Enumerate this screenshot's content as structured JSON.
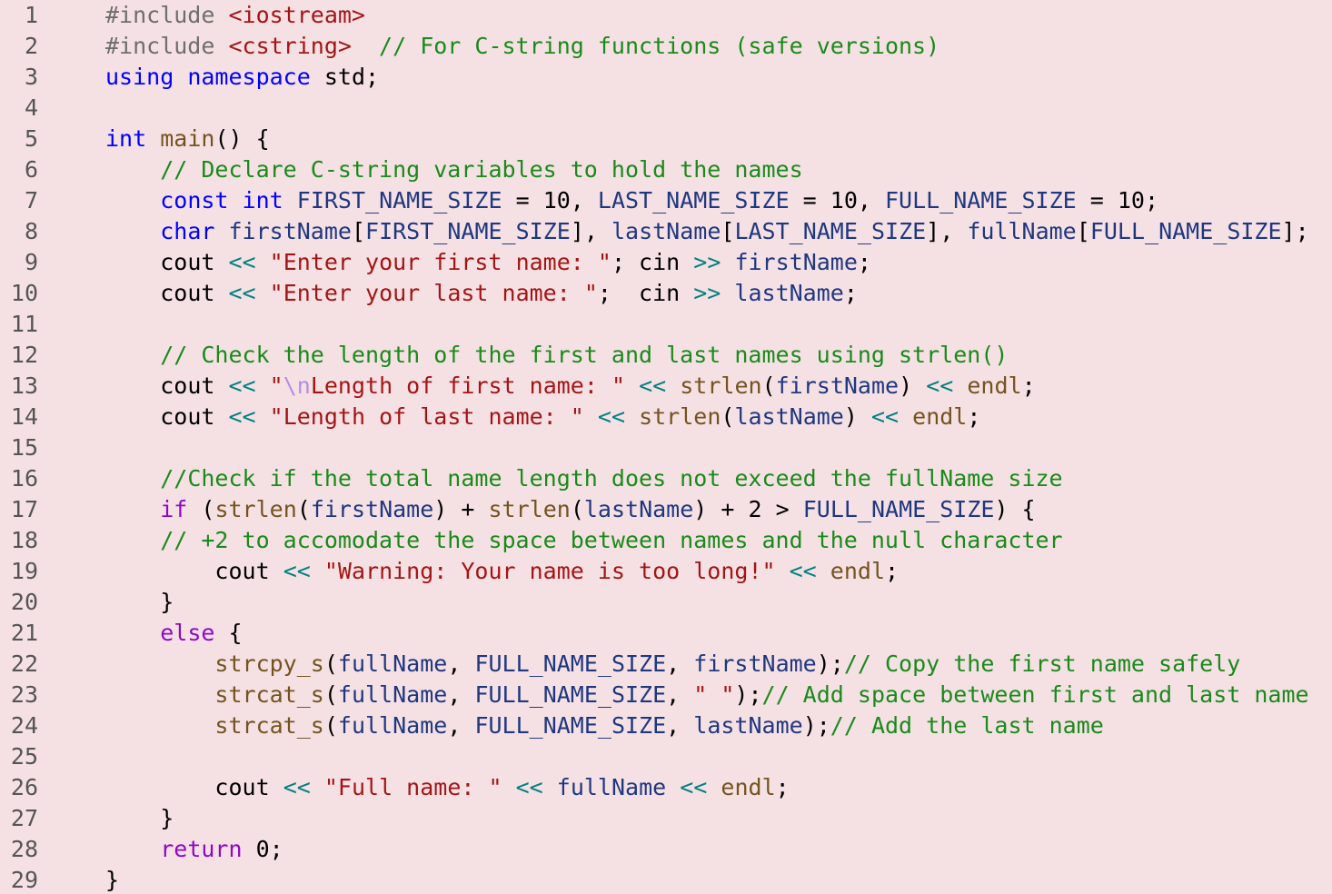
{
  "editor": {
    "indent_unit": "    ",
    "colors": {
      "background": "#f5e1e4",
      "line_number": "#555555",
      "preproc": "#6e6e6e",
      "header": "#a31515",
      "comment": "#1a8a1a",
      "keyword": "#0000ff",
      "control": "#8f08c4",
      "function": "#74531f",
      "string": "#a31515",
      "escape": "#b68ce6",
      "variable": "#1f377f",
      "operator": "#008080"
    },
    "lines": [
      {
        "n": "1",
        "indent": 0,
        "tokens": [
          [
            "preproc",
            "#include "
          ],
          [
            "header",
            "<iostream>"
          ]
        ]
      },
      {
        "n": "2",
        "indent": 0,
        "tokens": [
          [
            "preproc",
            "#include "
          ],
          [
            "header",
            "<cstring>"
          ],
          [
            "plain",
            "  "
          ],
          [
            "comment",
            "// For C-string functions (safe versions)"
          ]
        ]
      },
      {
        "n": "3",
        "indent": 0,
        "tokens": [
          [
            "keyword",
            "using"
          ],
          [
            "plain",
            " "
          ],
          [
            "keyword",
            "namespace"
          ],
          [
            "plain",
            " std;"
          ]
        ]
      },
      {
        "n": "4",
        "indent": 0,
        "tokens": []
      },
      {
        "n": "5",
        "indent": 0,
        "tokens": [
          [
            "keyword",
            "int"
          ],
          [
            "plain",
            " "
          ],
          [
            "func",
            "main"
          ],
          [
            "plain",
            "() {"
          ]
        ]
      },
      {
        "n": "6",
        "indent": 1,
        "tokens": [
          [
            "comment",
            "// Declare C-string variables to hold the names"
          ]
        ]
      },
      {
        "n": "7",
        "indent": 1,
        "tokens": [
          [
            "keyword",
            "const"
          ],
          [
            "plain",
            " "
          ],
          [
            "keyword",
            "int"
          ],
          [
            "plain",
            " "
          ],
          [
            "macro",
            "FIRST_NAME_SIZE"
          ],
          [
            "plain",
            " = 10, "
          ],
          [
            "macro",
            "LAST_NAME_SIZE"
          ],
          [
            "plain",
            " = 10, "
          ],
          [
            "macro",
            "FULL_NAME_SIZE"
          ],
          [
            "plain",
            " = 10;"
          ]
        ]
      },
      {
        "n": "8",
        "indent": 1,
        "tokens": [
          [
            "keyword",
            "char"
          ],
          [
            "plain",
            " "
          ],
          [
            "var",
            "firstName"
          ],
          [
            "plain",
            "["
          ],
          [
            "macro",
            "FIRST_NAME_SIZE"
          ],
          [
            "plain",
            "], "
          ],
          [
            "var",
            "lastName"
          ],
          [
            "plain",
            "["
          ],
          [
            "macro",
            "LAST_NAME_SIZE"
          ],
          [
            "plain",
            "], "
          ],
          [
            "var",
            "fullName"
          ],
          [
            "plain",
            "["
          ],
          [
            "macro",
            "FULL_NAME_SIZE"
          ],
          [
            "plain",
            "];"
          ]
        ]
      },
      {
        "n": "9",
        "indent": 1,
        "tokens": [
          [
            "plain",
            "cout "
          ],
          [
            "op",
            "<<"
          ],
          [
            "plain",
            " "
          ],
          [
            "string",
            "\"Enter your first name: \""
          ],
          [
            "plain",
            "; cin "
          ],
          [
            "op",
            ">>"
          ],
          [
            "plain",
            " "
          ],
          [
            "var",
            "firstName"
          ],
          [
            "plain",
            ";"
          ]
        ]
      },
      {
        "n": "10",
        "indent": 1,
        "tokens": [
          [
            "plain",
            "cout "
          ],
          [
            "op",
            "<<"
          ],
          [
            "plain",
            " "
          ],
          [
            "string",
            "\"Enter your last name: \""
          ],
          [
            "plain",
            ";  cin "
          ],
          [
            "op",
            ">>"
          ],
          [
            "plain",
            " "
          ],
          [
            "var",
            "lastName"
          ],
          [
            "plain",
            ";"
          ]
        ]
      },
      {
        "n": "11",
        "indent": 0,
        "tokens": []
      },
      {
        "n": "12",
        "indent": 1,
        "tokens": [
          [
            "comment",
            "// Check the length of the first and last names using strlen()"
          ]
        ]
      },
      {
        "n": "13",
        "indent": 1,
        "tokens": [
          [
            "plain",
            "cout "
          ],
          [
            "op",
            "<<"
          ],
          [
            "plain",
            " "
          ],
          [
            "string",
            "\""
          ],
          [
            "escape",
            "\\n"
          ],
          [
            "string",
            "Length of first name: \""
          ],
          [
            "plain",
            " "
          ],
          [
            "op",
            "<<"
          ],
          [
            "plain",
            " "
          ],
          [
            "func",
            "strlen"
          ],
          [
            "plain",
            "("
          ],
          [
            "var",
            "firstName"
          ],
          [
            "plain",
            ") "
          ],
          [
            "op",
            "<<"
          ],
          [
            "plain",
            " "
          ],
          [
            "func",
            "endl"
          ],
          [
            "plain",
            ";"
          ]
        ]
      },
      {
        "n": "14",
        "indent": 1,
        "tokens": [
          [
            "plain",
            "cout "
          ],
          [
            "op",
            "<<"
          ],
          [
            "plain",
            " "
          ],
          [
            "string",
            "\"Length of last name: \""
          ],
          [
            "plain",
            " "
          ],
          [
            "op",
            "<<"
          ],
          [
            "plain",
            " "
          ],
          [
            "func",
            "strlen"
          ],
          [
            "plain",
            "("
          ],
          [
            "var",
            "lastName"
          ],
          [
            "plain",
            ") "
          ],
          [
            "op",
            "<<"
          ],
          [
            "plain",
            " "
          ],
          [
            "func",
            "endl"
          ],
          [
            "plain",
            ";"
          ]
        ]
      },
      {
        "n": "15",
        "indent": 0,
        "tokens": []
      },
      {
        "n": "16",
        "indent": 1,
        "tokens": [
          [
            "comment",
            "//Check if the total name length does not exceed the fullName size"
          ]
        ]
      },
      {
        "n": "17",
        "indent": 1,
        "tokens": [
          [
            "control",
            "if"
          ],
          [
            "plain",
            " ("
          ],
          [
            "func",
            "strlen"
          ],
          [
            "plain",
            "("
          ],
          [
            "var",
            "firstName"
          ],
          [
            "plain",
            ") + "
          ],
          [
            "func",
            "strlen"
          ],
          [
            "plain",
            "("
          ],
          [
            "var",
            "lastName"
          ],
          [
            "plain",
            ") + 2 > "
          ],
          [
            "macro",
            "FULL_NAME_SIZE"
          ],
          [
            "plain",
            ") {"
          ]
        ]
      },
      {
        "n": "18",
        "indent": 1,
        "tokens": [
          [
            "comment",
            "// +2 to accomodate the space between names and the null character"
          ]
        ]
      },
      {
        "n": "19",
        "indent": 2,
        "tokens": [
          [
            "plain",
            "cout "
          ],
          [
            "op",
            "<<"
          ],
          [
            "plain",
            " "
          ],
          [
            "string",
            "\"Warning: Your name is too long!\""
          ],
          [
            "plain",
            " "
          ],
          [
            "op",
            "<<"
          ],
          [
            "plain",
            " "
          ],
          [
            "func",
            "endl"
          ],
          [
            "plain",
            ";"
          ]
        ]
      },
      {
        "n": "20",
        "indent": 1,
        "tokens": [
          [
            "plain",
            "}"
          ]
        ]
      },
      {
        "n": "21",
        "indent": 1,
        "tokens": [
          [
            "control",
            "else"
          ],
          [
            "plain",
            " {"
          ]
        ]
      },
      {
        "n": "22",
        "indent": 2,
        "tokens": [
          [
            "func",
            "strcpy_s"
          ],
          [
            "plain",
            "("
          ],
          [
            "var",
            "fullName"
          ],
          [
            "plain",
            ", "
          ],
          [
            "macro",
            "FULL_NAME_SIZE"
          ],
          [
            "plain",
            ", "
          ],
          [
            "var",
            "firstName"
          ],
          [
            "plain",
            ");"
          ],
          [
            "comment",
            "// Copy the first name safely"
          ]
        ]
      },
      {
        "n": "23",
        "indent": 2,
        "tokens": [
          [
            "func",
            "strcat_s"
          ],
          [
            "plain",
            "("
          ],
          [
            "var",
            "fullName"
          ],
          [
            "plain",
            ", "
          ],
          [
            "macro",
            "FULL_NAME_SIZE"
          ],
          [
            "plain",
            ", "
          ],
          [
            "string",
            "\" \""
          ],
          [
            "plain",
            ");"
          ],
          [
            "comment",
            "// Add space between first and last name"
          ]
        ]
      },
      {
        "n": "24",
        "indent": 2,
        "tokens": [
          [
            "func",
            "strcat_s"
          ],
          [
            "plain",
            "("
          ],
          [
            "var",
            "fullName"
          ],
          [
            "plain",
            ", "
          ],
          [
            "macro",
            "FULL_NAME_SIZE"
          ],
          [
            "plain",
            ", "
          ],
          [
            "var",
            "lastName"
          ],
          [
            "plain",
            ");"
          ],
          [
            "comment",
            "// Add the last name"
          ]
        ]
      },
      {
        "n": "25",
        "indent": 0,
        "tokens": []
      },
      {
        "n": "26",
        "indent": 2,
        "tokens": [
          [
            "plain",
            "cout "
          ],
          [
            "op",
            "<<"
          ],
          [
            "plain",
            " "
          ],
          [
            "string",
            "\"Full name: \""
          ],
          [
            "plain",
            " "
          ],
          [
            "op",
            "<<"
          ],
          [
            "plain",
            " "
          ],
          [
            "var",
            "fullName"
          ],
          [
            "plain",
            " "
          ],
          [
            "op",
            "<<"
          ],
          [
            "plain",
            " "
          ],
          [
            "func",
            "endl"
          ],
          [
            "plain",
            ";"
          ]
        ]
      },
      {
        "n": "27",
        "indent": 1,
        "tokens": [
          [
            "plain",
            "}"
          ]
        ]
      },
      {
        "n": "28",
        "indent": 1,
        "tokens": [
          [
            "control",
            "return"
          ],
          [
            "plain",
            " 0;"
          ]
        ]
      },
      {
        "n": "29",
        "indent": 0,
        "tokens": [
          [
            "plain",
            "}"
          ]
        ]
      }
    ]
  }
}
